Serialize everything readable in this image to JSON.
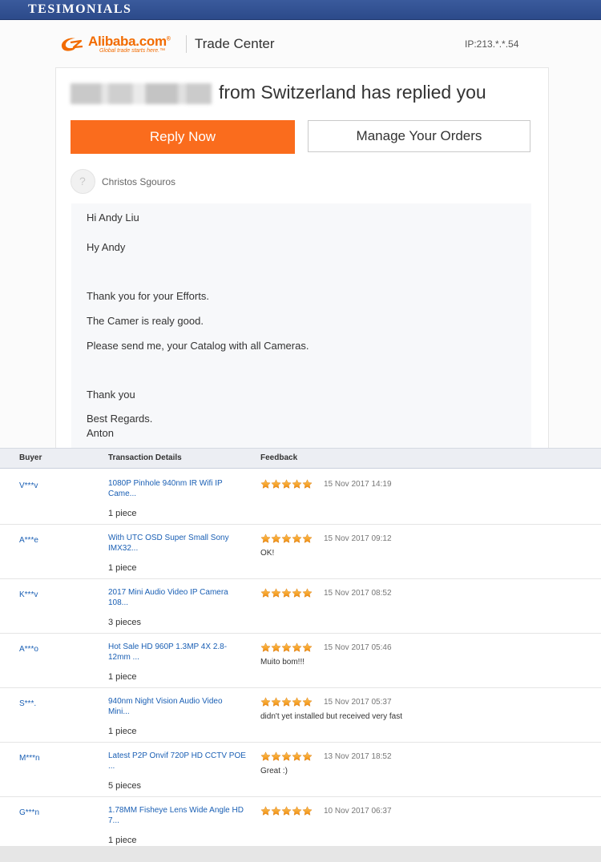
{
  "banner": {
    "title": "TESIMONIALS"
  },
  "header": {
    "logo_text": "Alibaba.com",
    "logo_sup": "®",
    "logo_tagline": "Global trade starts here.™",
    "app_name": "Trade Center",
    "ip": "IP:213.*.*.54"
  },
  "email": {
    "headline": "from Switzerland has replied you",
    "reply_button": "Reply Now",
    "manage_button": "Manage Your Orders",
    "avatar_glyph": "?",
    "sender": "Christos Sgouros",
    "message": [
      "Hi Andy Liu",
      "Hy Andy",
      "Thank you for your Efforts.",
      "The Camer is realy good.",
      "Please send me, your Catalog with all Cameras.",
      "Thank you",
      "Best Regards.",
      "Anton"
    ]
  },
  "table": {
    "headers": {
      "buyer": "Buyer",
      "details": "Transaction Details",
      "feedback": "Feedback"
    },
    "rows": [
      {
        "buyer": "V***v",
        "product_line1": "1080P Pinhole 940nm IR Wifi IP",
        "product_line2": "Came...",
        "quantity": "1 piece",
        "stars": 5,
        "date": "15 Nov 2017 14:19",
        "feedback": ""
      },
      {
        "buyer": "A***e",
        "product_line1": "With UTC OSD Super Small Sony",
        "product_line2": "IMX32...",
        "quantity": "1 piece",
        "stars": 5,
        "date": "15 Nov 2017 09:12",
        "feedback": "OK!"
      },
      {
        "buyer": "K***v",
        "product_line1": "2017 Mini Audio Video IP Camera",
        "product_line2": "108...",
        "quantity": "3 pieces",
        "stars": 5,
        "date": "15 Nov 2017 08:52",
        "feedback": ""
      },
      {
        "buyer": "A***o",
        "product_line1": "Hot Sale HD 960P 1.3MP 4X 2.8-",
        "product_line2": "12mm ...",
        "quantity": "1 piece",
        "stars": 5,
        "date": "15 Nov 2017 05:46",
        "feedback": "Muito bom!!!"
      },
      {
        "buyer": "S***.",
        "product_line1": "940nm Night Vision Audio Video",
        "product_line2": "Mini...",
        "quantity": "1 piece",
        "stars": 5,
        "date": "15 Nov 2017 05:37",
        "feedback": "didn't yet installed but received very fast"
      },
      {
        "buyer": "M***n",
        "product_line1": "Latest P2P Onvif 720P HD CCTV POE",
        "product_line2": "...",
        "quantity": "5 pieces",
        "stars": 5,
        "date": "13 Nov 2017 18:52",
        "feedback": "Great :)"
      },
      {
        "buyer": "G***n",
        "product_line1": "1.78MM Fisheye Lens Wide Angle HD",
        "product_line2": "7...",
        "quantity": "1 piece",
        "stars": 5,
        "date": "10 Nov 2017 06:37",
        "feedback": ""
      }
    ]
  },
  "colors": {
    "accent": "#fa6c1d",
    "banner": "#2f4f91",
    "link": "#1a5fb4",
    "star": "#f7a21b"
  }
}
